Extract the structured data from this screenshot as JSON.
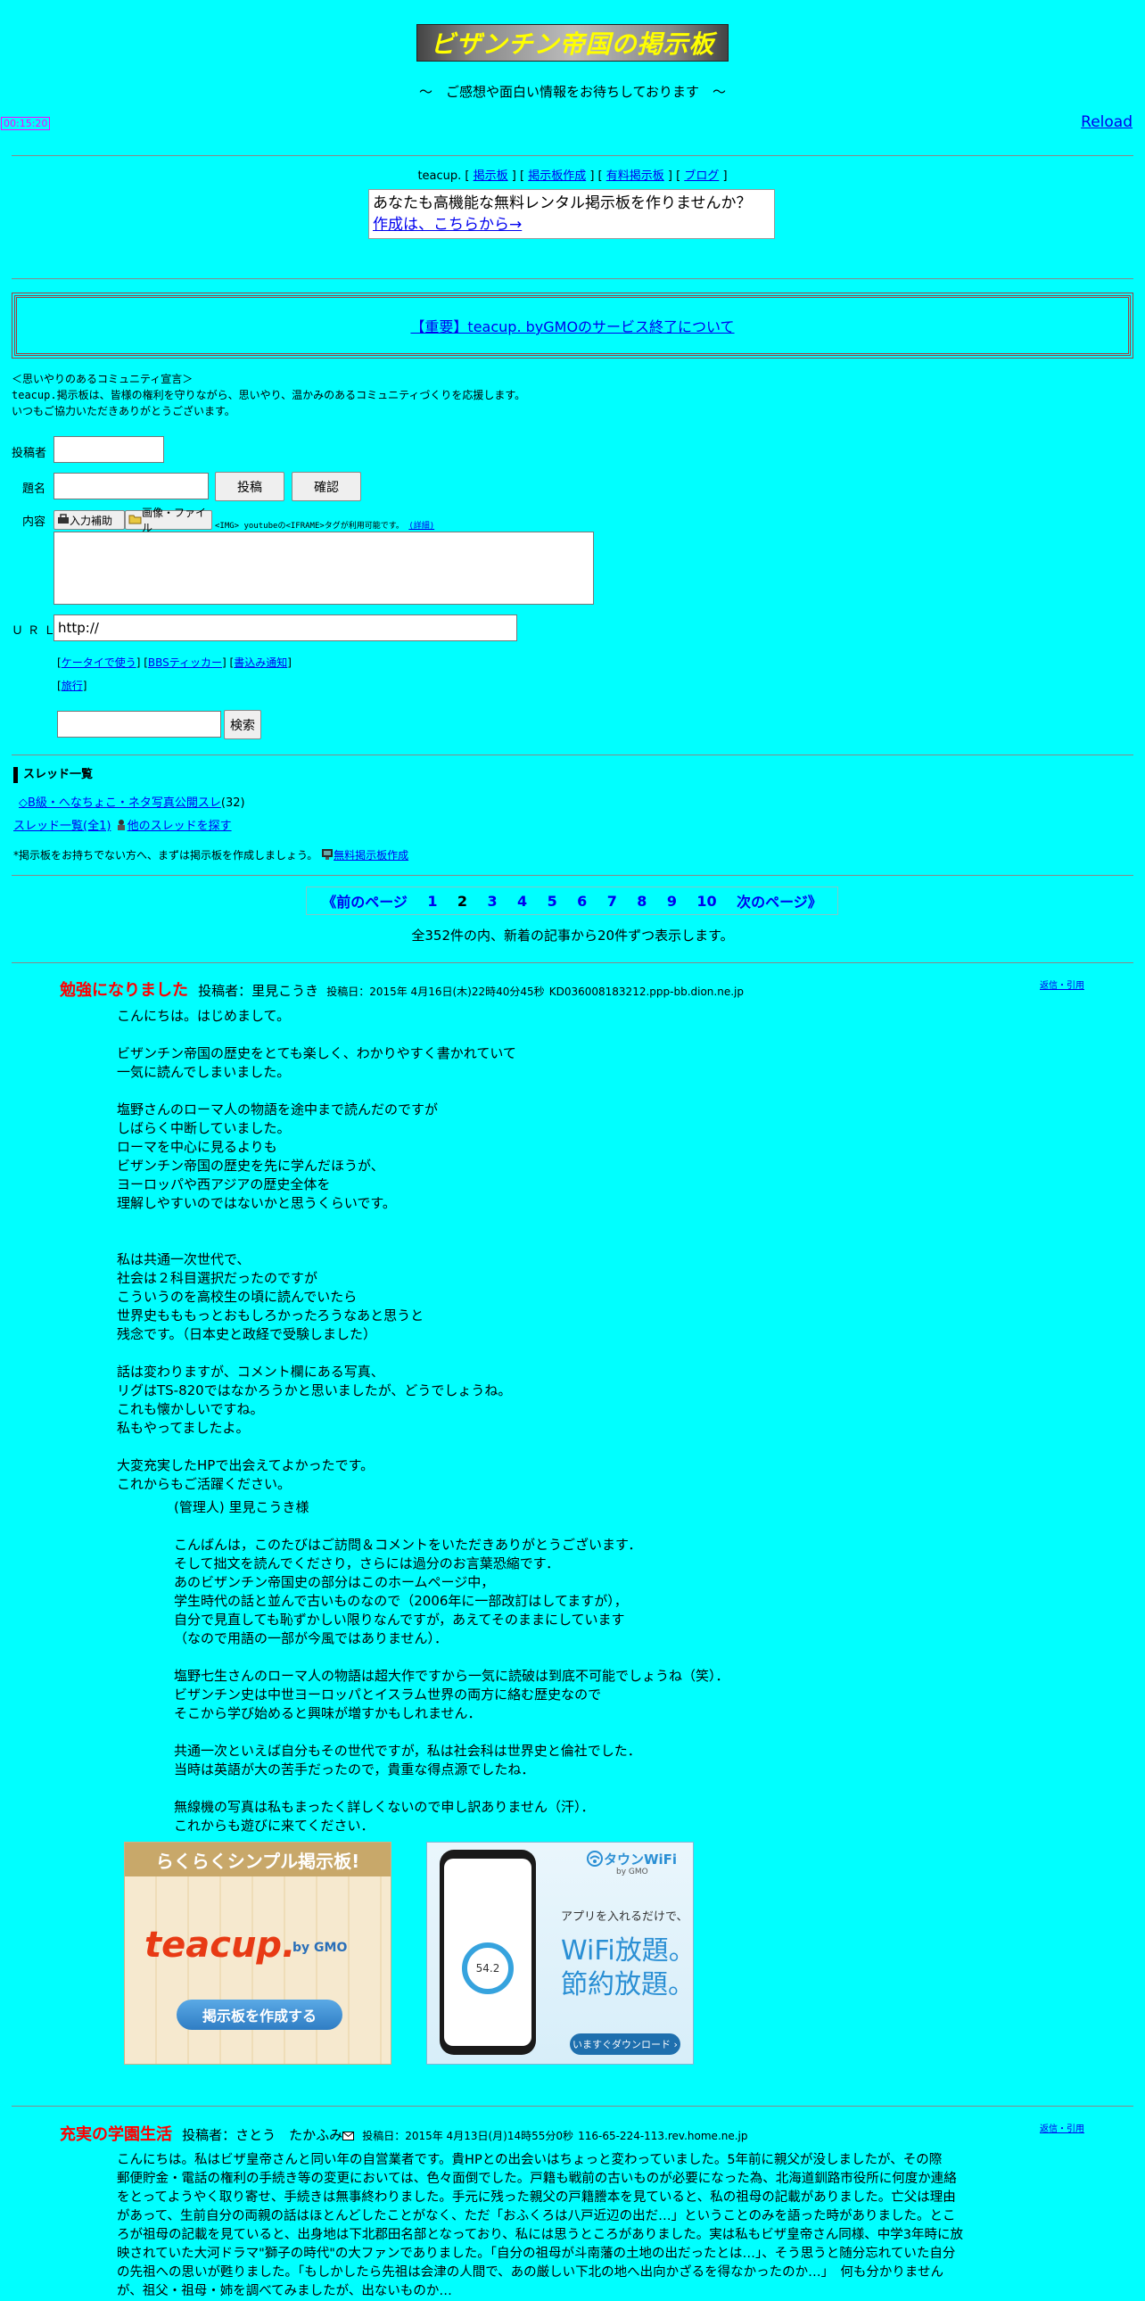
{
  "header": {
    "title": "ビザンチン帝国の掲示板",
    "subtitle": "～　ご感想や面白い情報をお待ちしております　～",
    "clock": "00:15:20",
    "reload": "Reload"
  },
  "teacup_nav": {
    "prefix": "teacup.",
    "links": [
      "掲示板",
      "掲示板作成",
      "有料掲示板",
      "ブログ"
    ]
  },
  "ad_box": {
    "line1": "あなたも高機能な無料レンタル掲示板を作りませんか？",
    "line2": "作成は、こちらから→"
  },
  "notice": {
    "text": "【重要】teacup. byGMOのサービス終了について"
  },
  "declaration": {
    "line1": "＜思いやりのあるコミュニティ宣言＞",
    "line2": "teacup.掲示板は、皆様の権利を守りながら、思いやり、温かみのあるコミュニティづくりを応援します。",
    "line3": "いつもご協力いただきありがとうございます。"
  },
  "form": {
    "author_label": "投稿者",
    "subject_label": "題名",
    "post_button": "投稿",
    "confirm_button": "確認",
    "content_label": "内容",
    "input_help": "入力補助",
    "image_file": "画像・ファイル",
    "tag_note": "<IMG> youtubeの<IFRAME>タグが利用可能です。",
    "tag_detail": "(詳細)",
    "url_label": "ＵＲＬ",
    "url_value": "http://",
    "links1": [
      "ケータイで使う",
      "BBSティッカー",
      "書込み通知"
    ],
    "links2": [
      "旅行"
    ],
    "search_button": "検索"
  },
  "threads": {
    "heading": "スレッド一覧",
    "item": "◇B級・へなちょこ・ネタ写真公開スレ",
    "item_count": "(32)",
    "list_all": "スレッド一覧(全1)",
    "other": "他のスレッドを探す",
    "create_note": "*掲示板をお持ちでない方へ、まずは掲示板を作成しましょう。",
    "create_link": "無料掲示板作成"
  },
  "pager": {
    "prev": "《前のページ",
    "pages": [
      "1",
      "2",
      "3",
      "4",
      "5",
      "6",
      "7",
      "8",
      "9",
      "10"
    ],
    "current": "2",
    "next": "次のページ》",
    "summary": "全352件の内、新着の記事から20件ずつ表示します。"
  },
  "post1": {
    "title": "勉強になりました",
    "author": "投稿者：里見こうき",
    "date": "投稿日：2015年 4月16日(木)22時40分45秒",
    "host": "KD036008183212.ppp-bb.dion.ne.jp",
    "reply": "返信・引用",
    "body": "こんにちは。はじめまして。\n\nビザンチン帝国の歴史をとても楽しく、わかりやすく書かれていて\n一気に読んでしまいました。\n\n塩野さんのローマ人の物語を途中まで読んだのですが\nしばらく中断していました。\nローマを中心に見るよりも\nビザンチン帝国の歴史を先に学んだほうが、\nヨーロッパや西アジアの歴史全体を\n理解しやすいのではないかと思うくらいです。\n\n\n私は共通一次世代で、\n社会は２科目選択だったのですが\nこういうのを高校生の頃に読んでいたら\n世界史もももっとおもしろかったろうなあと思うと\n残念です。（日本史と政経で受験しました）\n\n話は変わりますが、コメント欄にある写真、\nリグはTS-820ではなかろうかと思いましたが、どうでしょうね。\nこれも懐かしいですね。\n私もやってましたよ。\n\n大変充実したHPで出会えてよかったです。\nこれからもご活躍ください。",
    "admin_reply": "(管理人) 里見こうき様\n\nこんばんは，このたびはご訪問＆コメントをいただきありがとうございます．\nそして拙文を読んでくださり，さらには過分のお言葉恐縮です．\nあのビザンチン帝国史の部分はこのホームページ中，\n学生時代の話と並んで古いものなので（2006年に一部改訂はしてますが），\n自分で見直しても恥ずかしい限りなんですが，あえてそのままにしています\n（なので用語の一部が今風ではありません）．\n\n塩野七生さんのローマ人の物語は超大作ですから一気に読破は到底不可能でしょうね（笑）．\nビザンチン史は中世ヨーロッパとイスラム世界の両方に絡む歴史なので\nそこから学び始めると興味が増すかもしれません．\n\n共通一次といえば自分もその世代ですが，私は社会科は世界史と倫社でした．\n当時は英語が大の苦手だったので，貴重な得点源でしたね．\n\n無線機の写真は私もまったく詳しくないので申し訳ありません（汗）．\nこれからも遊びに来てください．"
  },
  "banner1": {
    "top": "らくらくシンプル掲示板!",
    "logo": "teacup.",
    "by": "by GMO",
    "button": "掲示板を作成する"
  },
  "banner2": {
    "brand": "タウンWiFi",
    "by": "by GMO",
    "line1": "アプリを入れるだけで、",
    "line2": "WiFi放題。",
    "line3": "節約放題。",
    "button": "いますぐダウンロード ›",
    "phone_value": "54.2"
  },
  "post2": {
    "title": "充実の学園生活",
    "author": "投稿者：さとう　たかふみ",
    "date": "投稿日：2015年 4月13日(月)14時55分0秒",
    "host": "116-65-224-113.rev.home.ne.jp",
    "reply": "返信・引用",
    "body": "こんにちは。私はビザ皇帝さんと同い年の自営業者です。貴HPとの出会いはちょっと変わっていました。5年前に親父が没しましたが、その際\n郵便貯金・電話の権利の手続き等の変更においては、色々面倒でした。戸籍も戦前の古いものが必要になった為、北海道釧路市役所に何度か連絡\nをとってようやく取り寄せ、手続きは無事終わりました。手元に残った親父の戸籍謄本を見ていると、私の祖母の記載がありました。亡父は理由\nがあって、生前自分の両親の話はほとんどしたことがなく、ただ「おふくろは八戸近辺の出だ…」ということのみを語った時がありました。とこ\nろが祖母の記載を見ていると、出身地は下北郡田名部となっており、私には思うところがありました。実は私もビザ皇帝さん同様、中学3年時に放\n映されていた大河ドラマ\"獅子の時代\"の大ファンでありました。「自分の祖母が斗南藩の土地の出だったとは…」、そう思うと随分忘れていた自分\nの先祖への思いが甦りました。「もしかしたら先祖は会津の人間で、あの厳しい下北の地へ出向かざるを得なかったのか…」　何も分かりません\nが、祖父・祖母・姉を調べてみましたが、出ないものか…"
  }
}
